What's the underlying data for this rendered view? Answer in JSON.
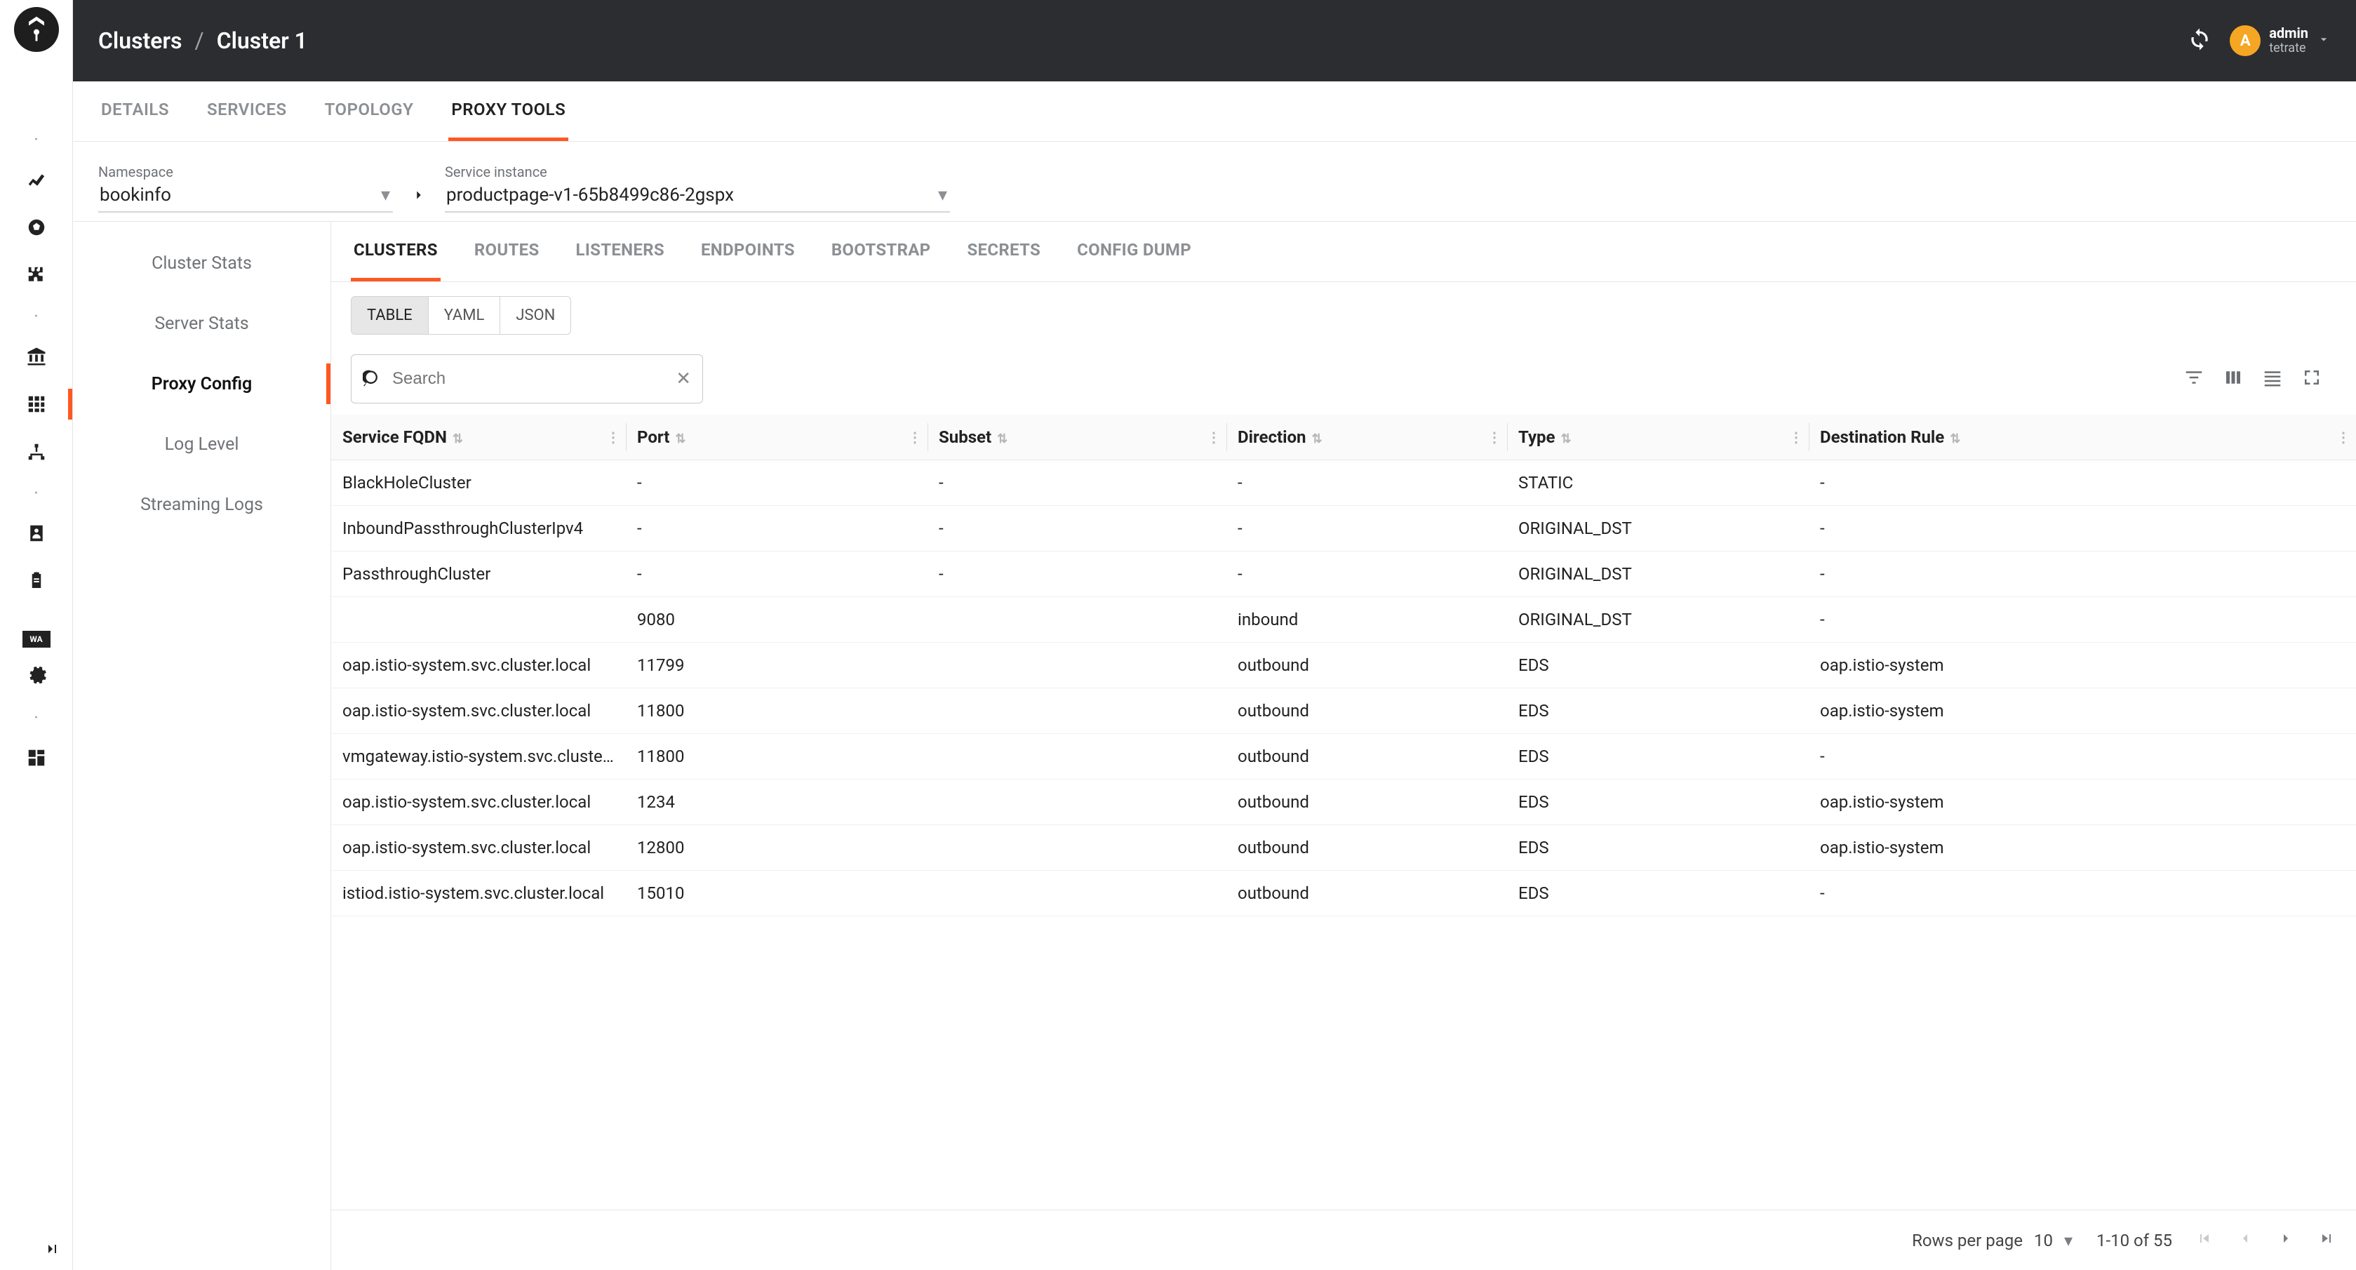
{
  "breadcrumb": {
    "root": "Clusters",
    "leaf": "Cluster 1"
  },
  "user": {
    "initial": "A",
    "name": "admin",
    "org": "tetrate"
  },
  "page_tabs": [
    "DETAILS",
    "SERVICES",
    "TOPOLOGY",
    "PROXY TOOLS"
  ],
  "page_tabs_active": 3,
  "namespace": {
    "label": "Namespace",
    "value": "bookinfo"
  },
  "instance": {
    "label": "Service instance",
    "value": "productpage-v1-65b8499c86-2gspx"
  },
  "side_menu": [
    "Cluster Stats",
    "Server Stats",
    "Proxy Config",
    "Log Level",
    "Streaming Logs"
  ],
  "side_menu_active": 2,
  "sub_tabs": [
    "CLUSTERS",
    "ROUTES",
    "LISTENERS",
    "ENDPOINTS",
    "BOOTSTRAP",
    "SECRETS",
    "CONFIG DUMP"
  ],
  "sub_tabs_active": 0,
  "format_toggle": [
    "TABLE",
    "YAML",
    "JSON"
  ],
  "format_active": 0,
  "search_placeholder": "Search",
  "columns": [
    "Service FQDN",
    "Port",
    "Subset",
    "Direction",
    "Type",
    "Destination Rule"
  ],
  "rows": [
    {
      "fqdn": "BlackHoleCluster",
      "port": "-",
      "subset": "-",
      "dir": "-",
      "type": "STATIC",
      "dest": "-"
    },
    {
      "fqdn": "InboundPassthroughClusterIpv4",
      "port": "-",
      "subset": "-",
      "dir": "-",
      "type": "ORIGINAL_DST",
      "dest": "-"
    },
    {
      "fqdn": "PassthroughCluster",
      "port": "-",
      "subset": "-",
      "dir": "-",
      "type": "ORIGINAL_DST",
      "dest": "-"
    },
    {
      "fqdn": "",
      "port": "9080",
      "subset": "",
      "dir": "inbound",
      "type": "ORIGINAL_DST",
      "dest": "-"
    },
    {
      "fqdn": "oap.istio-system.svc.cluster.local",
      "port": "11799",
      "subset": "",
      "dir": "outbound",
      "type": "EDS",
      "dest": "oap.istio-system"
    },
    {
      "fqdn": "oap.istio-system.svc.cluster.local",
      "port": "11800",
      "subset": "",
      "dir": "outbound",
      "type": "EDS",
      "dest": "oap.istio-system"
    },
    {
      "fqdn": "vmgateway.istio-system.svc.cluster.local",
      "port": "11800",
      "subset": "",
      "dir": "outbound",
      "type": "EDS",
      "dest": "-"
    },
    {
      "fqdn": "oap.istio-system.svc.cluster.local",
      "port": "1234",
      "subset": "",
      "dir": "outbound",
      "type": "EDS",
      "dest": "oap.istio-system"
    },
    {
      "fqdn": "oap.istio-system.svc.cluster.local",
      "port": "12800",
      "subset": "",
      "dir": "outbound",
      "type": "EDS",
      "dest": "oap.istio-system"
    },
    {
      "fqdn": "istiod.istio-system.svc.cluster.local",
      "port": "15010",
      "subset": "",
      "dir": "outbound",
      "type": "EDS",
      "dest": "-"
    }
  ],
  "pagination": {
    "rows_per_page_label": "Rows per page",
    "rows_per_page": "10",
    "range": "1-10 of 55"
  },
  "wa_badge": "WA"
}
